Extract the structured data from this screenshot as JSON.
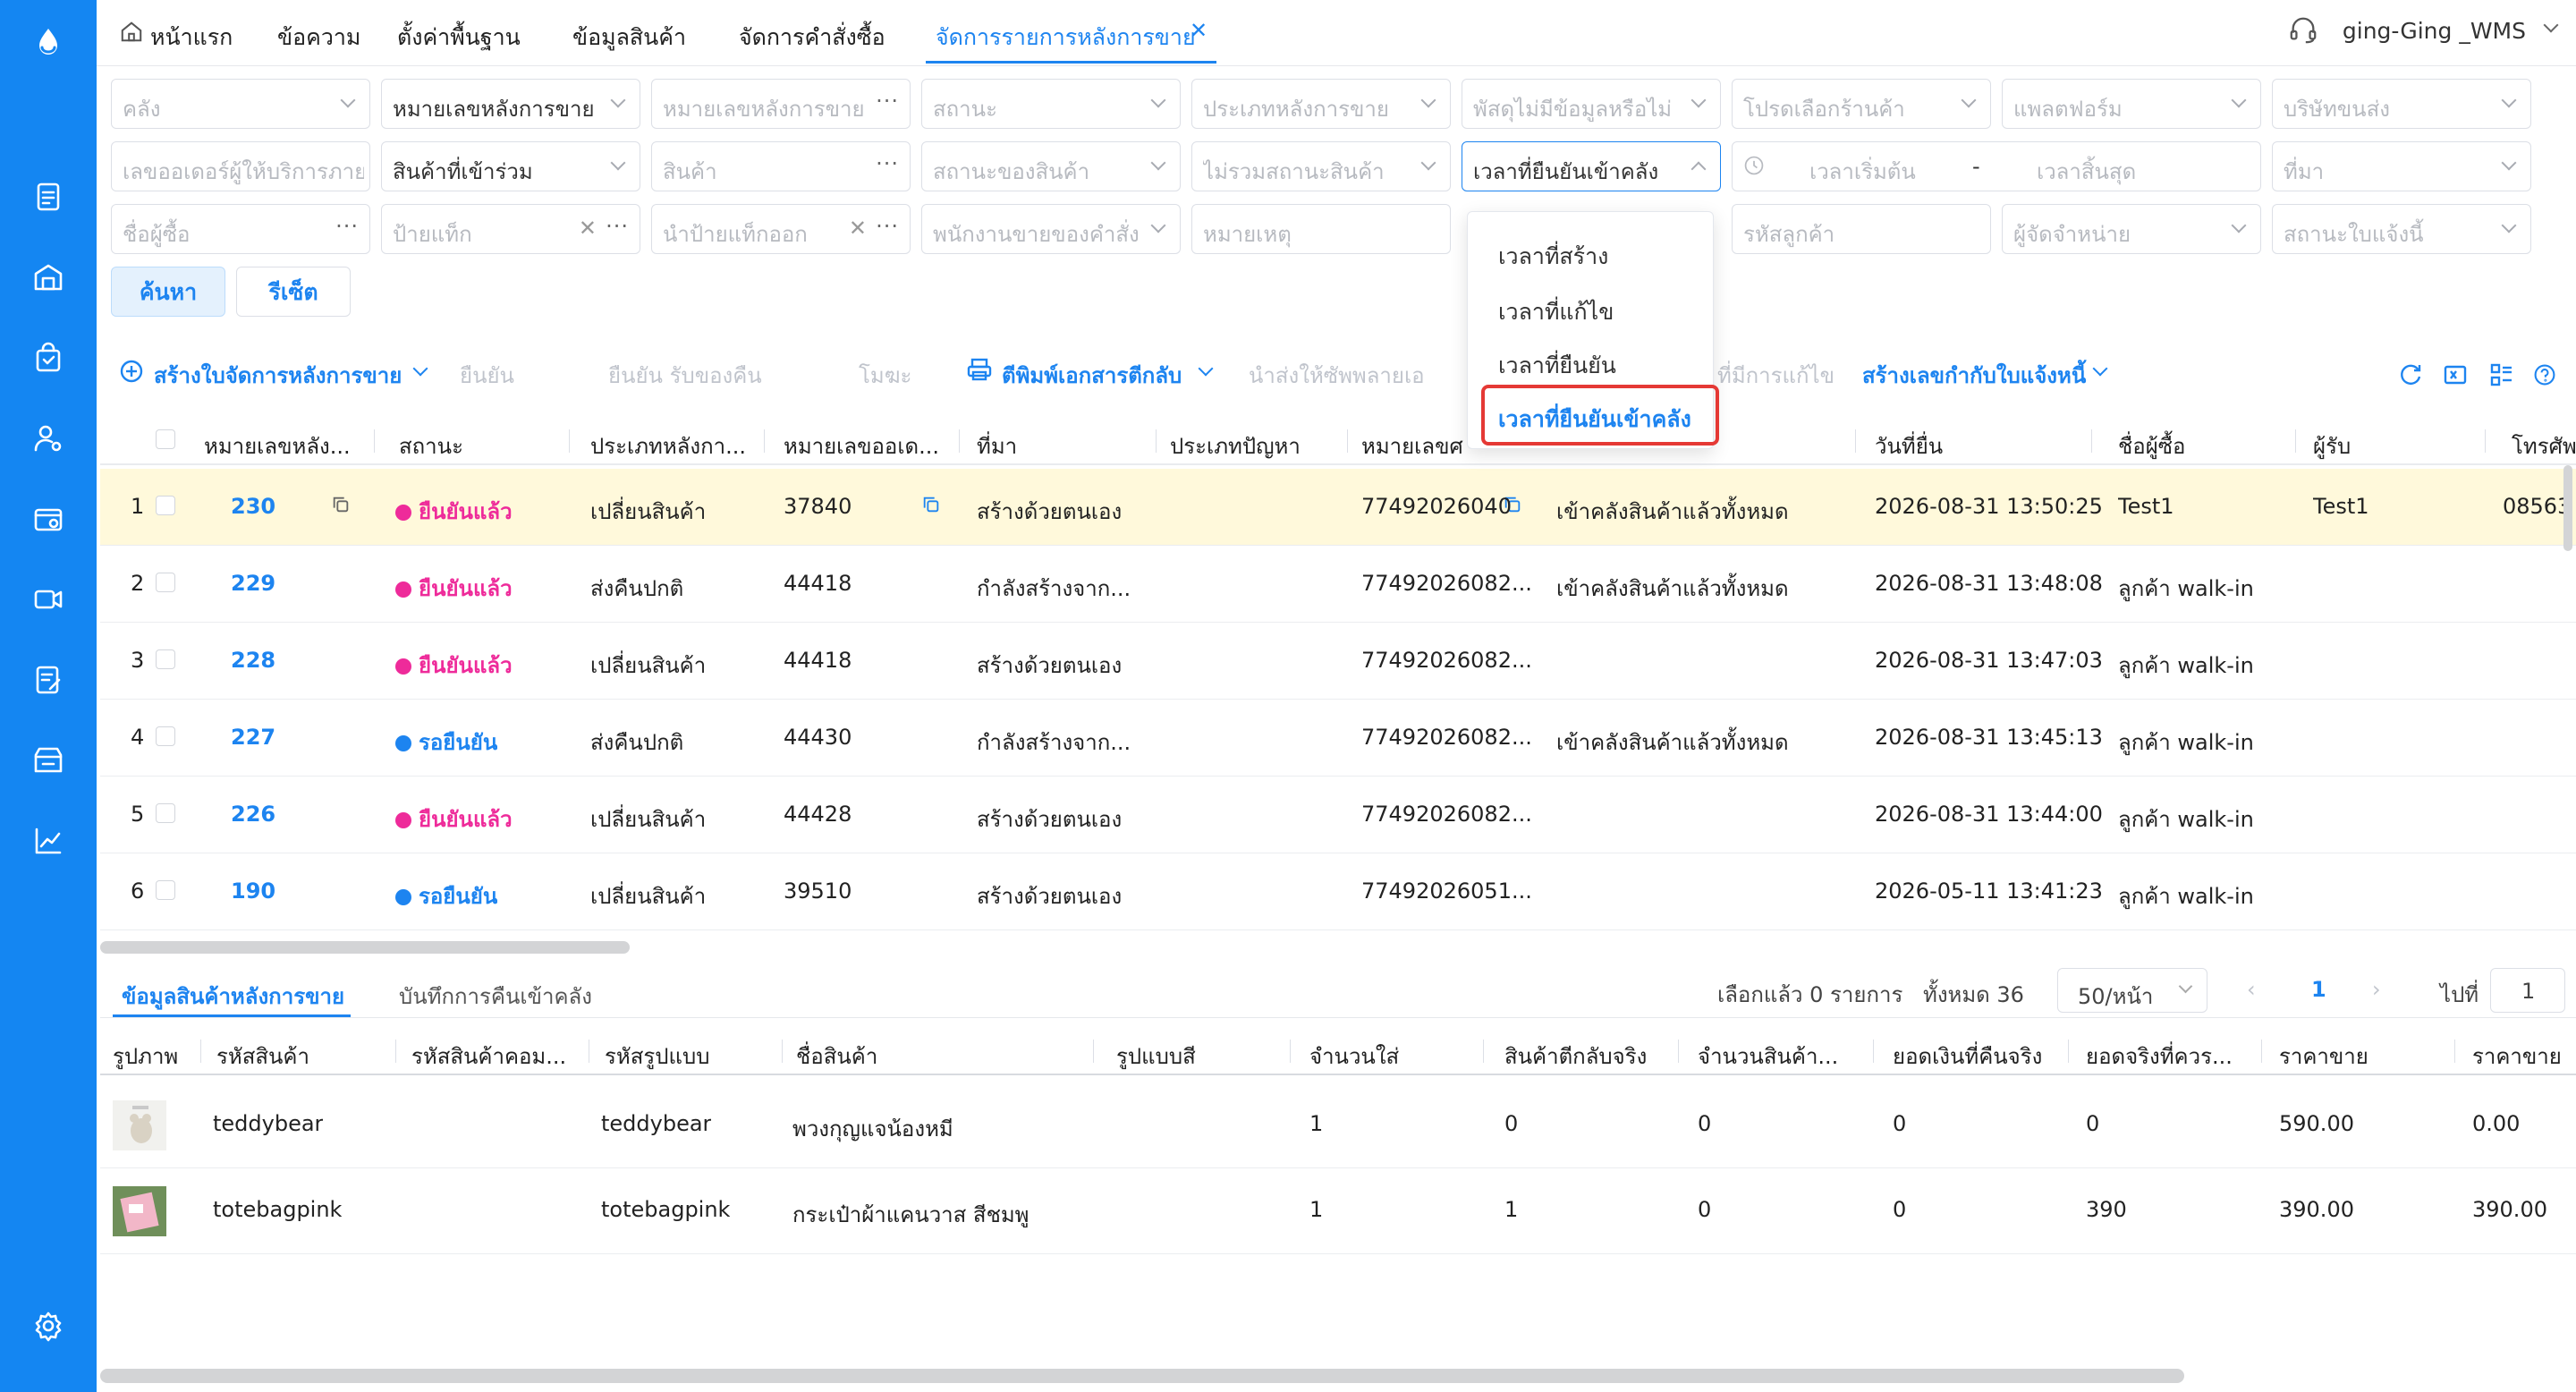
{
  "nav_tabs": [
    "หน้าแรก",
    "ข้อความ",
    "ตั้งค่าพื้นฐาน",
    "ข้อมูลสินค้า",
    "จัดการคำสั่งซื้อ",
    "จัดการรายการหลังการขาย"
  ],
  "user": "ging-Ging _WMS",
  "filters": {
    "warehouse": "คลัง",
    "order_type_select": "หมายเลขหลังการขาย",
    "order_no": "หมายเลขหลังการขาย",
    "status": "สถานะ",
    "aftersale_type": "ประเภทหลังการขาย",
    "has_info": "พัสดุไม่มีข้อมูลหรือไม่",
    "store": "โปรดเลือกร้านค้า",
    "platform": "แพลตฟอร์ม",
    "carrier": "บริษัทขนส่ง",
    "provider_order": "เลขออเดอร์ผู้ให้บริการภาย",
    "product_filter": "สินค้าที่เข้าร่วม",
    "product": "สินค้า",
    "product_status": "สถานะของสินค้า",
    "exclude_status": "ไม่รวมสถานะสินค้า",
    "time_type": "เวลาที่ยืนยันเข้าคลัง",
    "start_time": "เวลาเริ่มต้น",
    "time_sep": "-",
    "end_time": "เวลาสิ้นสุด",
    "source": "ที่มา",
    "buyer": "ชื่อผู้ซื้อ",
    "tag": "ป้ายแท็ก",
    "remove_tag": "นำป้ายแท็กออก",
    "sales_staff": "พนักงานขายของคำสั่ง",
    "note": "หมายเหตุ",
    "customer_code": "รหัสลูกค้า",
    "distributor": "ผู้จัดจำหน่าย",
    "invoice_status": "สถานะใบแจ้งนี้",
    "search_btn": "ค้นหา",
    "reset_btn": "รีเซ็ต"
  },
  "dropdown": {
    "options": [
      "เวลาที่สร้าง",
      "เวลาที่แก้ไข",
      "เวลาที่ยืนยัน",
      "เวลาที่ยืนยันเข้าคลัง"
    ],
    "selected": "เวลาที่ยืนยันเข้าคลัง"
  },
  "toolbar": {
    "create": "สร้างใบจัดการหลังการขาย",
    "confirm": "ยืนยัน",
    "confirm_receive": "ยืนยัน รับของคืน",
    "void": "โมฆะ",
    "print": "ตีพิมพ์เอกสารตีกลับ",
    "send_supplier": "นำส่งให้ซัพพลายเอ",
    "modified": "ที่มีการแก้ไข",
    "create_invoice": "สร้างเลขกำกับใบแจ้งหนี้"
  },
  "main_table": {
    "headers": [
      "หมายเลขหลัง...",
      "สถานะ",
      "ประเภทหลังกา...",
      "หมายเลขออเด...",
      "ที่มา",
      "ประเภทปัญหา",
      "หมายเลขศ",
      "",
      "วันที่ยื่น",
      "ชื่อผู้ซื้อ",
      "ผู้รับ",
      "โทรศัพ"
    ],
    "rows": [
      {
        "idx": "1",
        "no": "230",
        "status": "ยืนยันแล้ว",
        "status_color": "#ee2b9a",
        "type": "เปลี่ยนสินค้า",
        "order": "37840",
        "source": "สร้างด้วยตนเอง",
        "tracking": "77492026040",
        "warehouse": "เข้าคลังสินค้าแล้วทั้งหมด",
        "date": "2026-08-31 13:50:25",
        "buyer": "Test1",
        "receiver": "Test1",
        "phone": "08563"
      },
      {
        "idx": "2",
        "no": "229",
        "status": "ยืนยันแล้ว",
        "status_color": "#ee2b9a",
        "type": "ส่งคืนปกติ",
        "order": "44418",
        "source": "กำลังสร้างจาก...",
        "tracking": "77492026082...",
        "warehouse": "เข้าคลังสินค้าแล้วทั้งหมด",
        "date": "2026-08-31 13:48:08",
        "buyer": "ลูกค้า walk-in",
        "receiver": "",
        "phone": ""
      },
      {
        "idx": "3",
        "no": "228",
        "status": "ยืนยันแล้ว",
        "status_color": "#ee2b9a",
        "type": "เปลี่ยนสินค้า",
        "order": "44418",
        "source": "สร้างด้วยตนเอง",
        "tracking": "77492026082...",
        "warehouse": "",
        "date": "2026-08-31 13:47:03",
        "buyer": "ลูกค้า walk-in",
        "receiver": "",
        "phone": ""
      },
      {
        "idx": "4",
        "no": "227",
        "status": "รอยืนยัน",
        "status_color": "#1d84f0",
        "type": "ส่งคืนปกติ",
        "order": "44430",
        "source": "กำลังสร้างจาก...",
        "tracking": "77492026082...",
        "warehouse": "เข้าคลังสินค้าแล้วทั้งหมด",
        "date": "2026-08-31 13:45:13",
        "buyer": "ลูกค้า walk-in",
        "receiver": "",
        "phone": ""
      },
      {
        "idx": "5",
        "no": "226",
        "status": "ยืนยันแล้ว",
        "status_color": "#ee2b9a",
        "type": "เปลี่ยนสินค้า",
        "order": "44428",
        "source": "สร้างด้วยตนเอง",
        "tracking": "77492026082...",
        "warehouse": "",
        "date": "2026-08-31 13:44:00",
        "buyer": "ลูกค้า walk-in",
        "receiver": "",
        "phone": ""
      },
      {
        "idx": "6",
        "no": "190",
        "status": "รอยืนยัน",
        "status_color": "#1d84f0",
        "type": "เปลี่ยนสินค้า",
        "order": "39510",
        "source": "สร้างด้วยตนเอง",
        "tracking": "77492026051...",
        "warehouse": "",
        "date": "2026-05-11 13:41:23",
        "buyer": "ลูกค้า walk-in",
        "receiver": "",
        "phone": ""
      }
    ]
  },
  "bottom": {
    "tab_products": "ข้อมูลสินค้าหลังการขาย",
    "tab_records": "บันทึกการคืนเข้าคลัง",
    "selected": "เลือกแล้ว 0 รายการ",
    "total": "ทั้งหมด 36",
    "per_page": "50/หน้า",
    "page": "1",
    "goto": "ไปที่",
    "goto_val": "1",
    "headers": [
      "รูปภาพ",
      "รหัสสินค้า",
      "รหัสสินค้าคอม...",
      "รหัสรูปแบบ",
      "ชื่อสินค้า",
      "รูปแบบสี",
      "จำนวนใส่",
      "สินค้าตีกลับจริง",
      "จำนวนสินค้า...",
      "ยอดเงินที่คืนจริง",
      "ยอดจริงที่ควร...",
      "ราคาขาย",
      "ราคาขาย"
    ],
    "rows": [
      {
        "sku": "teddybear",
        "combo": "",
        "model": "teddybear",
        "name": "พวงกุญแจน้องหมี",
        "color": "",
        "qty": "1",
        "returned": "0",
        "count": "0",
        "refund": "0",
        "due": "0",
        "price": "590.00",
        "price2": "0.00"
      },
      {
        "sku": "totebagpink",
        "combo": "",
        "model": "totebagpink",
        "name": "กระเป๋าผ้าแคนวาส สีชมพู",
        "color": "",
        "qty": "1",
        "returned": "1",
        "count": "0",
        "refund": "0",
        "due": "390",
        "price": "390.00",
        "price2": "390.00"
      }
    ]
  },
  "icons": {
    "rail": [
      "logo-icon",
      "document-icon",
      "warehouse-icon",
      "bag-icon",
      "user-gear-icon",
      "box-icon",
      "video-icon",
      "edit-list-icon",
      "store-icon",
      "chart-icon",
      "settings-icon"
    ]
  }
}
